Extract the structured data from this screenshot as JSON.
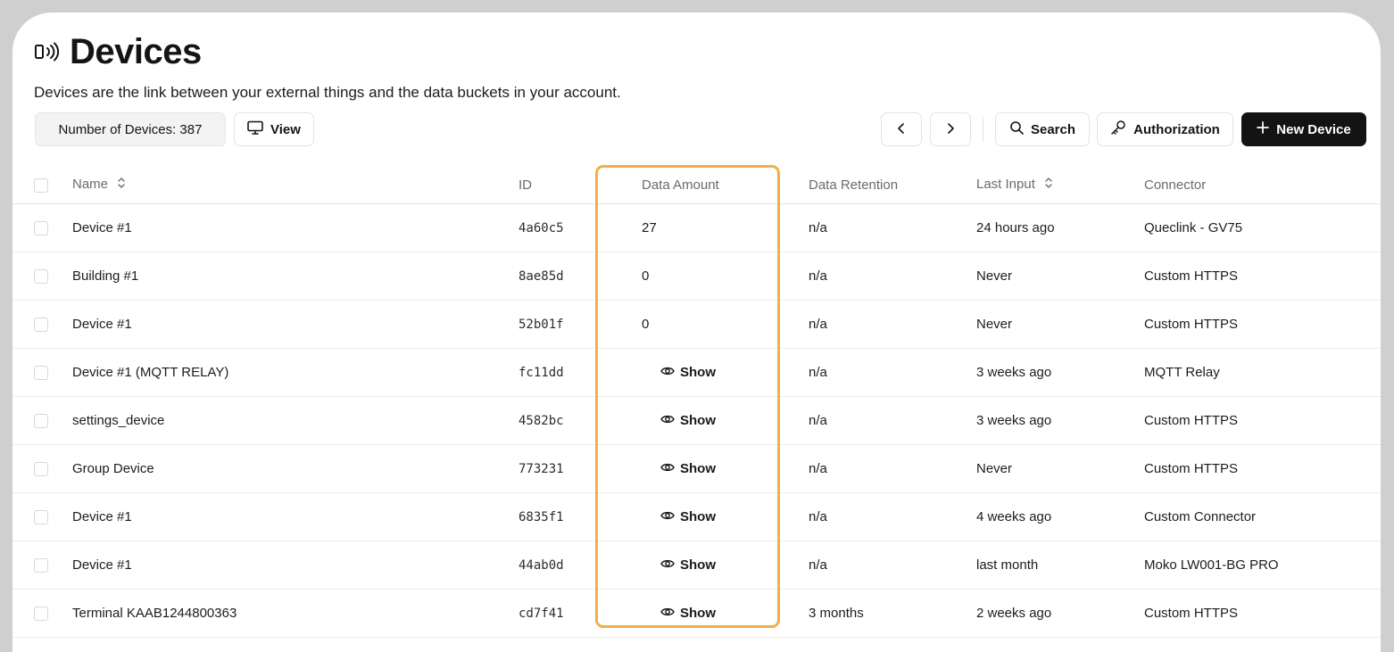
{
  "header": {
    "icon": "device-signal-icon",
    "title": "Devices",
    "subtitle": "Devices are the link between your external things and the data buckets in your account."
  },
  "toolbar": {
    "count_label": "Number of Devices: 387",
    "view_label": "View",
    "search_label": "Search",
    "auth_label": "Authorization",
    "new_label": "New Device"
  },
  "table": {
    "columns": [
      "Name",
      "ID",
      "Data Amount",
      "Data Retention",
      "Last Input",
      "Connector"
    ],
    "rows": [
      {
        "name": "Device #1",
        "id": "4a60c5",
        "amount": "27",
        "retention": "n/a",
        "last": "24 hours ago",
        "connector": "Queclink - GV75"
      },
      {
        "name": "Building #1",
        "id": "8ae85d",
        "amount": "0",
        "retention": "n/a",
        "last": "Never",
        "connector": "Custom HTTPS"
      },
      {
        "name": "Device #1",
        "id": "52b01f",
        "amount": "0",
        "retention": "n/a",
        "last": "Never",
        "connector": "Custom HTTPS"
      },
      {
        "name": "Device #1 (MQTT RELAY)",
        "id": "fc11dd",
        "amount": "Show",
        "retention": "n/a",
        "last": "3 weeks ago",
        "connector": "MQTT Relay"
      },
      {
        "name": "settings_device",
        "id": "4582bc",
        "amount": "Show",
        "retention": "n/a",
        "last": "3 weeks ago",
        "connector": "Custom HTTPS"
      },
      {
        "name": "Group Device",
        "id": "773231",
        "amount": "Show",
        "retention": "n/a",
        "last": "Never",
        "connector": "Custom HTTPS"
      },
      {
        "name": "Device #1",
        "id": "6835f1",
        "amount": "Show",
        "retention": "n/a",
        "last": "4 weeks ago",
        "connector": "Custom Connector"
      },
      {
        "name": "Device #1",
        "id": "44ab0d",
        "amount": "Show",
        "retention": "n/a",
        "last": "last month",
        "connector": "Moko LW001-BG PRO"
      },
      {
        "name": "Terminal KAAB1244800363",
        "id": "cd7f41",
        "amount": "Show",
        "retention": "3 months",
        "last": "2 weeks ago",
        "connector": "Custom HTTPS"
      }
    ]
  },
  "colors": {
    "highlight": "#f5ae46",
    "primary_button": "#131313"
  }
}
